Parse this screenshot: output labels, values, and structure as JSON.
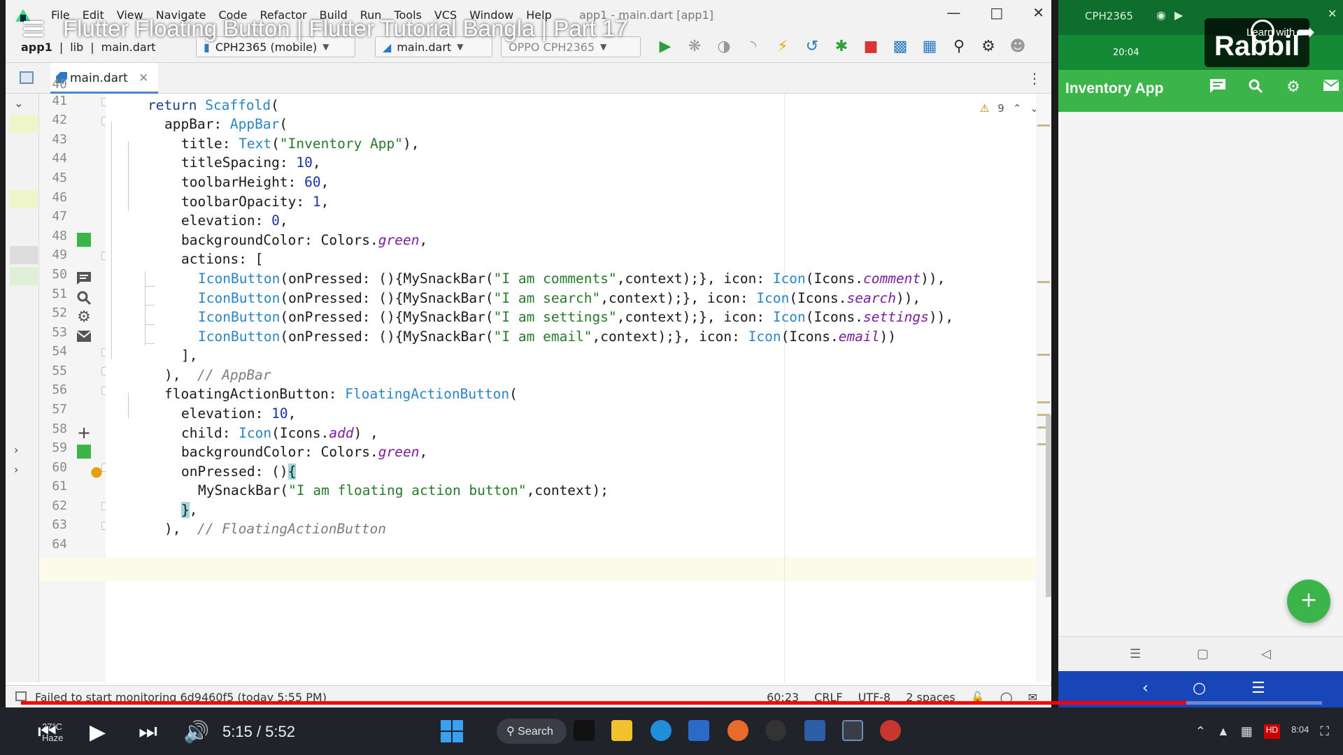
{
  "video": {
    "title": "Flutter Floating Button | Flutter Tutorial Bangla | Part 17",
    "time_current": "5:15",
    "time_separator": " / ",
    "time_total": "5:52",
    "progress": 0.8955
  },
  "menu": {
    "items": [
      "File",
      "Edit",
      "View",
      "Navigate",
      "Code",
      "Refactor",
      "Build",
      "Run",
      "Tools",
      "VCS",
      "Window",
      "Help"
    ],
    "window_title": "app1 - main.dart [app1]"
  },
  "toolbar": {
    "crumbs": [
      "app1",
      "lib",
      "main.dart"
    ],
    "device": "CPH2365 (mobile)",
    "run_config": "main.dart",
    "target": "OPPO CPH2365"
  },
  "tabs": [
    {
      "label": "main.dart"
    }
  ],
  "editor": {
    "inspections_count": "9",
    "lines": [
      "40",
      "41",
      "42",
      "43",
      "44",
      "45",
      "46",
      "47",
      "48",
      "49",
      "50",
      "51",
      "52",
      "53",
      "54",
      "55",
      "56",
      "57",
      "58",
      "59",
      "60",
      "61",
      "62",
      "63",
      "64"
    ]
  },
  "status": {
    "message": "Failed to start monitoring 6d9460f5 (today 5:55 PM)",
    "position": "60:23",
    "line_sep": "CRLF",
    "encoding": "UTF-8",
    "indent": "2 spaces"
  },
  "emulator": {
    "device": "CPH2365",
    "clock": "20:04",
    "app_title": "Inventory App",
    "actions": [
      "comment-icon",
      "search-icon",
      "settings-icon",
      "email-icon"
    ],
    "accent": "#3bb54a"
  },
  "channel": {
    "line1": "Learn with",
    "line2": "Rabbil"
  },
  "taskbar": {
    "weather_temp": "27°C",
    "weather_desc": "Haze",
    "search_label": "Search",
    "tray_time": "8:04"
  }
}
